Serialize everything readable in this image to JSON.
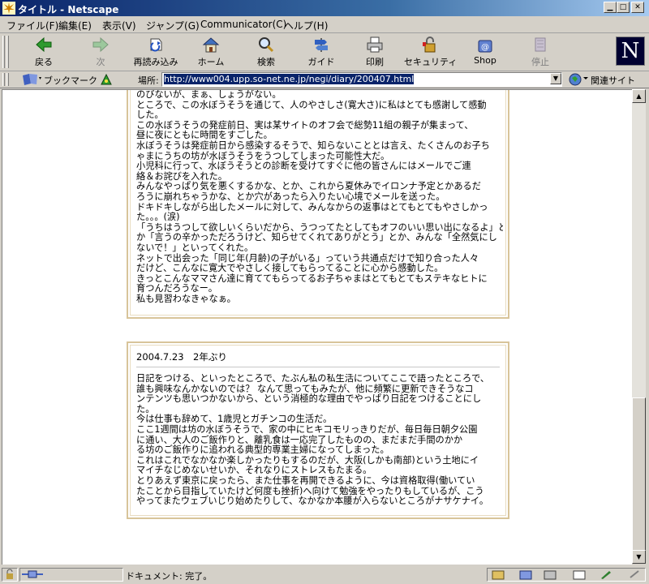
{
  "window": {
    "title": "タイトル - Netscape"
  },
  "menu": [
    "ファイル(F)",
    "編集(E)",
    "表示(V)",
    "ジャンプ(G)",
    "Communicator(C)",
    "ヘルプ(H)"
  ],
  "toolbar": {
    "back": "戻る",
    "forward": "次",
    "reload": "再読み込み",
    "home": "ホーム",
    "search": "検索",
    "guide": "ガイド",
    "print": "印刷",
    "security": "セキュリティ",
    "shop": "Shop",
    "stop": "停止"
  },
  "location": {
    "bookmarks_label": "ブックマーク",
    "label": "場所:",
    "url": "http://www004.upp.so-net.ne.jp/negi/diary/200407.html",
    "related_label": "関連サイト"
  },
  "logo": {
    "letter": "N"
  },
  "entries": [
    {
      "body": "のびないが、まぁ、しょうがない。\nところで、この水ぼうそうを通じて、人のやさしさ(寛大さ)に私はとても感謝して感動\nした。\nこの水ぼうそうの発症前日、実は某サイトのオフ会で総勢11組の親子が集まって、\n昼に夜にともに時間をすごした。\n水ぼうそうは発症前日から感染するそうで、知らないこととは言え、たくさんのお子ち\nゃまにうちの坊が水ぼうそうをうつしてしまった可能性大だ。\n小児科に行って、水ぼうそうとの診断を受けてすぐに他の皆さんにはメールでご連\n絡＆お詫びを入れた。\nみんなやっぱり気を悪くするかな、とか、これから夏休みでイロンナ予定とかあるだ\nろうに崩れちゃうかな、とか穴があったら入りたい心境でメールを送った。\nドキドキしながら出したメールに対して、みんなからの返事はとてもとてもやさしかっ\nた。。。(涙)\n「うちはうつして欲しいくらいだから、うつってたとしてもオフのいい思い出になるよ」と\nか「言うの辛かっただろうけど、知らせてくれてありがとう」とか、みんな「全然気にし\nないで！」といってくれた。\nネットで出会った「同じ年(月齢)の子がいる」っていう共通点だけで知り合った人々\nだけど、こんなに寛大でやさしく接してもらってることに心から感動した。\nきっとこんなママさん達に育ててもらってるお子ちゃまはとてもとてもステキなヒトに\n育つんだろうなー。\n私も見習わなきゃなぁ。"
    },
    {
      "heading": "2004.7.23　2年ぶり",
      "body": "日記をつける、といったところで、たぶん私の私生活についてここで語ったところで、\n誰も興味なんかないのでは？ なんて思ってもみたが、他に頻繁に更新できそうなコ\nンテンツも思いつかないから、という消極的な理由でやっぱり日記をつけることにし\nた。\n今は仕事も辞めて、1歳児とガチンコの生活だ。\nここ1週間は坊の水ぼうそうで、家の中にヒキコモリっきりだが、毎日毎日朝夕公園\nに通い、大人のご飯作りと、離乳食は一応完了したものの、まだまだ手間のかか\nる坊のご飯作りに追われる典型的専業主婦になってしまった。\nこれはこれでなかなか楽しかったりもするのだが、大阪(しかも南部)という土地にイ\nマイチなじめないせいか、それなりにストレスもたまる。\nとりあえず東京に戻ったら、また仕事を再開できるように、今は資格取得(働いてい\nたことから目指していたけど何度も挫折)へ向けて勉強をやったりもしているが、こう\nやってまたウェブいじり始めたりして、なかなか本腰が入らないところがナサケナイ。"
    }
  ],
  "status": {
    "text": "ドキュメント: 完了。"
  }
}
